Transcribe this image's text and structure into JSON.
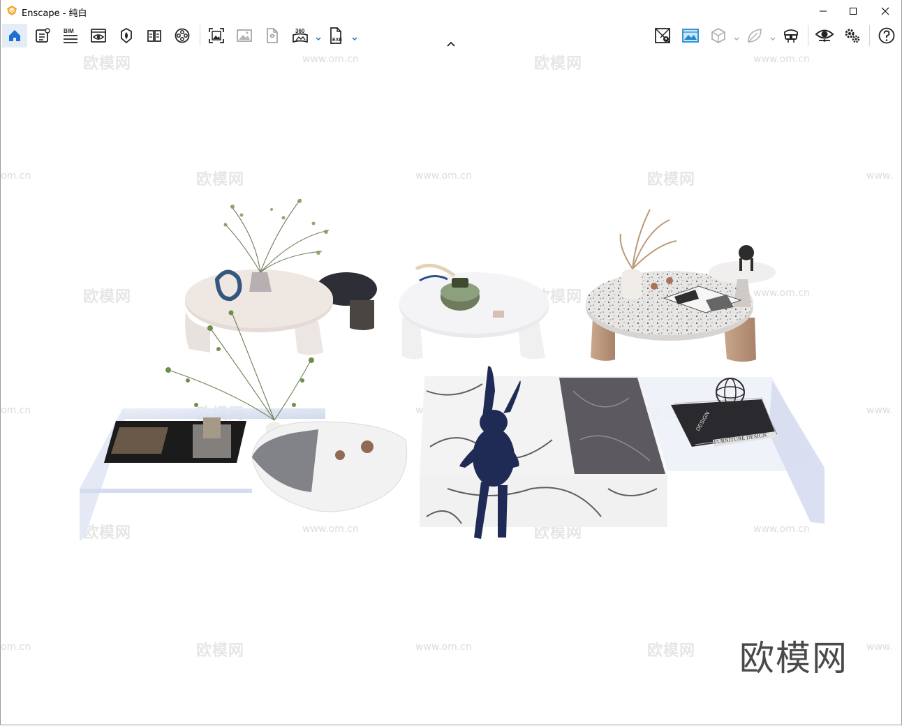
{
  "window": {
    "title": "Enscape - 纯白",
    "accent": "#f5a623"
  },
  "toolbar": {
    "left_tools": [
      {
        "name": "home-icon",
        "active": true
      },
      {
        "name": "asset-library-icon"
      },
      {
        "name": "bim-icon",
        "label": "BIM"
      },
      {
        "name": "view-management-icon"
      },
      {
        "name": "sun-icon"
      },
      {
        "name": "book-icon"
      },
      {
        "name": "film-reel-icon"
      }
    ],
    "export_tools": [
      {
        "name": "screenshot-icon"
      },
      {
        "name": "image-icon"
      },
      {
        "name": "file-export-icon"
      },
      {
        "name": "panorama-360-icon",
        "label": "360"
      },
      {
        "name": "exe-export-icon",
        "label": "EXE"
      }
    ],
    "right_tools": [
      {
        "name": "map-icon"
      },
      {
        "name": "background-image-icon"
      },
      {
        "name": "cube-icon"
      },
      {
        "name": "leaf-icon"
      },
      {
        "name": "vr-headset-icon"
      },
      {
        "name": "eye-icon"
      },
      {
        "name": "settings-icon"
      },
      {
        "name": "help-icon"
      }
    ]
  },
  "viewport": {
    "watermark_text": "欧模网",
    "watermark_url": "www.om.cn",
    "watermark_url_partial_left": "om.cn",
    "watermark_url_partial_right": "www.",
    "brand": "欧模网",
    "scene_text": {
      "book_title": "FURNITURE DESIGN",
      "book_spine": "DESIGN"
    }
  }
}
